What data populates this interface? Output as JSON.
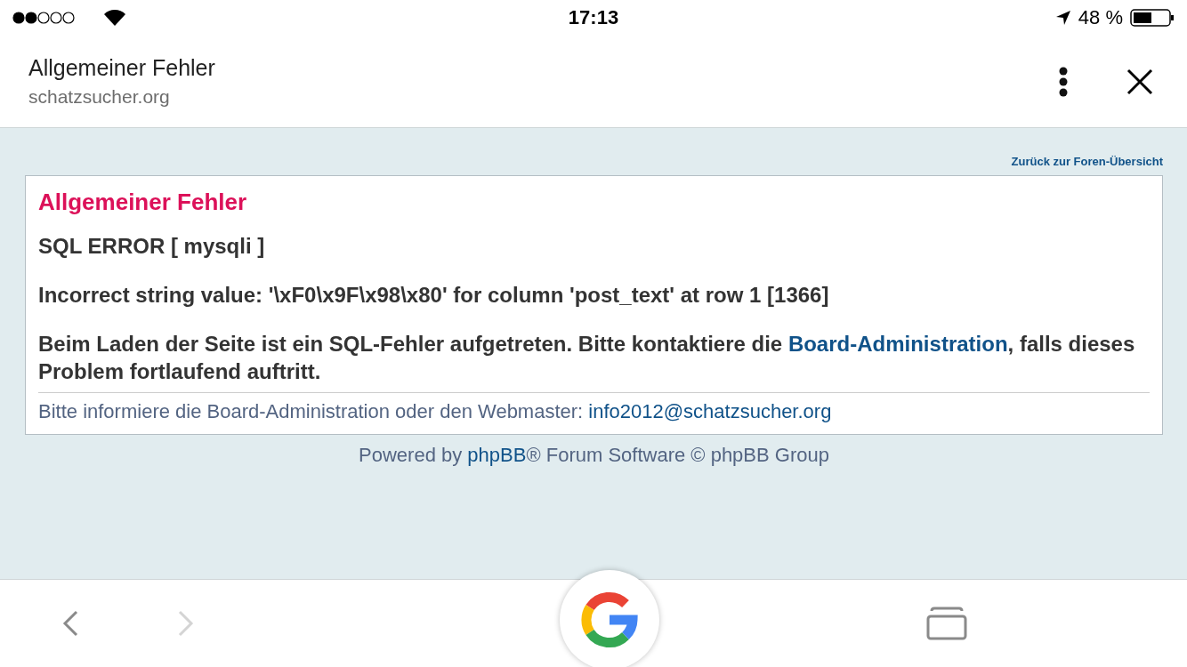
{
  "status_bar": {
    "time": "17:13",
    "battery": "48 %"
  },
  "header": {
    "title": "Allgemeiner Fehler",
    "url": "schatzsucher.org"
  },
  "page": {
    "back_link": "Zurück zur Foren-Übersicht",
    "error": {
      "heading": "Allgemeiner Fehler",
      "sql_title": "SQL ERROR [ mysqli ]",
      "sql_message": "Incorrect string value: '\\xF0\\x9F\\x98\\x80' for column 'post_text' at row 1 [1366]",
      "notice": {
        "before": "Beim Laden der Seite ist ein SQL-Fehler aufgetreten. Bitte kontaktiere die ",
        "link": "Board-Administration",
        "after": ", falls dieses Problem fortlaufend auftritt."
      },
      "contact": {
        "text": "Bitte informiere die Board-Administration oder den Webmaster: ",
        "email": "info2012@schatzsucher.org"
      }
    },
    "powered": {
      "before": "Powered by ",
      "link": "phpBB",
      "after": "® Forum Software © phpBB Group"
    }
  },
  "toolbar": [
    {
      "kind": "back",
      "disabled": false
    },
    {
      "kind": "forward",
      "disabled": true
    },
    {
      "kind": "search"
    },
    {
      "kind": "tabs"
    }
  ]
}
